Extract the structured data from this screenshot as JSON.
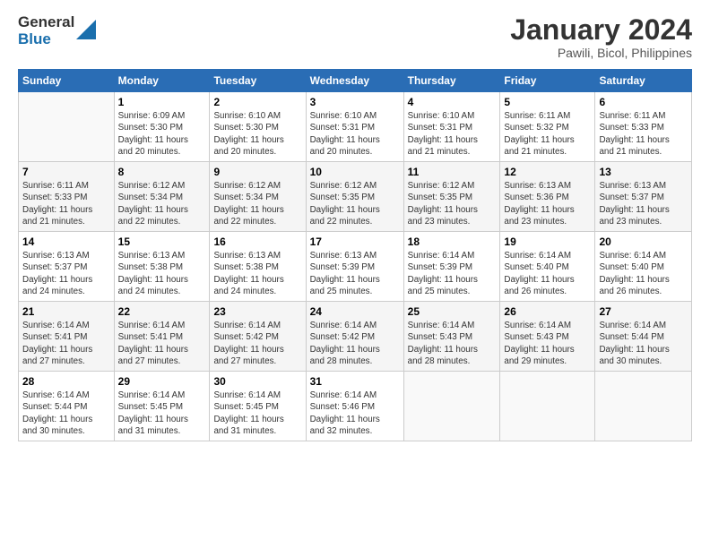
{
  "logo": {
    "general": "General",
    "blue": "Blue"
  },
  "title": "January 2024",
  "subtitle": "Pawili, Bicol, Philippines",
  "headers": [
    "Sunday",
    "Monday",
    "Tuesday",
    "Wednesday",
    "Thursday",
    "Friday",
    "Saturday"
  ],
  "weeks": [
    [
      {
        "day": "",
        "info": ""
      },
      {
        "day": "1",
        "info": "Sunrise: 6:09 AM\nSunset: 5:30 PM\nDaylight: 11 hours\nand 20 minutes."
      },
      {
        "day": "2",
        "info": "Sunrise: 6:10 AM\nSunset: 5:30 PM\nDaylight: 11 hours\nand 20 minutes."
      },
      {
        "day": "3",
        "info": "Sunrise: 6:10 AM\nSunset: 5:31 PM\nDaylight: 11 hours\nand 20 minutes."
      },
      {
        "day": "4",
        "info": "Sunrise: 6:10 AM\nSunset: 5:31 PM\nDaylight: 11 hours\nand 21 minutes."
      },
      {
        "day": "5",
        "info": "Sunrise: 6:11 AM\nSunset: 5:32 PM\nDaylight: 11 hours\nand 21 minutes."
      },
      {
        "day": "6",
        "info": "Sunrise: 6:11 AM\nSunset: 5:33 PM\nDaylight: 11 hours\nand 21 minutes."
      }
    ],
    [
      {
        "day": "7",
        "info": "Sunrise: 6:11 AM\nSunset: 5:33 PM\nDaylight: 11 hours\nand 21 minutes."
      },
      {
        "day": "8",
        "info": "Sunrise: 6:12 AM\nSunset: 5:34 PM\nDaylight: 11 hours\nand 22 minutes."
      },
      {
        "day": "9",
        "info": "Sunrise: 6:12 AM\nSunset: 5:34 PM\nDaylight: 11 hours\nand 22 minutes."
      },
      {
        "day": "10",
        "info": "Sunrise: 6:12 AM\nSunset: 5:35 PM\nDaylight: 11 hours\nand 22 minutes."
      },
      {
        "day": "11",
        "info": "Sunrise: 6:12 AM\nSunset: 5:35 PM\nDaylight: 11 hours\nand 23 minutes."
      },
      {
        "day": "12",
        "info": "Sunrise: 6:13 AM\nSunset: 5:36 PM\nDaylight: 11 hours\nand 23 minutes."
      },
      {
        "day": "13",
        "info": "Sunrise: 6:13 AM\nSunset: 5:37 PM\nDaylight: 11 hours\nand 23 minutes."
      }
    ],
    [
      {
        "day": "14",
        "info": "Sunrise: 6:13 AM\nSunset: 5:37 PM\nDaylight: 11 hours\nand 24 minutes."
      },
      {
        "day": "15",
        "info": "Sunrise: 6:13 AM\nSunset: 5:38 PM\nDaylight: 11 hours\nand 24 minutes."
      },
      {
        "day": "16",
        "info": "Sunrise: 6:13 AM\nSunset: 5:38 PM\nDaylight: 11 hours\nand 24 minutes."
      },
      {
        "day": "17",
        "info": "Sunrise: 6:13 AM\nSunset: 5:39 PM\nDaylight: 11 hours\nand 25 minutes."
      },
      {
        "day": "18",
        "info": "Sunrise: 6:14 AM\nSunset: 5:39 PM\nDaylight: 11 hours\nand 25 minutes."
      },
      {
        "day": "19",
        "info": "Sunrise: 6:14 AM\nSunset: 5:40 PM\nDaylight: 11 hours\nand 26 minutes."
      },
      {
        "day": "20",
        "info": "Sunrise: 6:14 AM\nSunset: 5:40 PM\nDaylight: 11 hours\nand 26 minutes."
      }
    ],
    [
      {
        "day": "21",
        "info": "Sunrise: 6:14 AM\nSunset: 5:41 PM\nDaylight: 11 hours\nand 27 minutes."
      },
      {
        "day": "22",
        "info": "Sunrise: 6:14 AM\nSunset: 5:41 PM\nDaylight: 11 hours\nand 27 minutes."
      },
      {
        "day": "23",
        "info": "Sunrise: 6:14 AM\nSunset: 5:42 PM\nDaylight: 11 hours\nand 27 minutes."
      },
      {
        "day": "24",
        "info": "Sunrise: 6:14 AM\nSunset: 5:42 PM\nDaylight: 11 hours\nand 28 minutes."
      },
      {
        "day": "25",
        "info": "Sunrise: 6:14 AM\nSunset: 5:43 PM\nDaylight: 11 hours\nand 28 minutes."
      },
      {
        "day": "26",
        "info": "Sunrise: 6:14 AM\nSunset: 5:43 PM\nDaylight: 11 hours\nand 29 minutes."
      },
      {
        "day": "27",
        "info": "Sunrise: 6:14 AM\nSunset: 5:44 PM\nDaylight: 11 hours\nand 30 minutes."
      }
    ],
    [
      {
        "day": "28",
        "info": "Sunrise: 6:14 AM\nSunset: 5:44 PM\nDaylight: 11 hours\nand 30 minutes."
      },
      {
        "day": "29",
        "info": "Sunrise: 6:14 AM\nSunset: 5:45 PM\nDaylight: 11 hours\nand 31 minutes."
      },
      {
        "day": "30",
        "info": "Sunrise: 6:14 AM\nSunset: 5:45 PM\nDaylight: 11 hours\nand 31 minutes."
      },
      {
        "day": "31",
        "info": "Sunrise: 6:14 AM\nSunset: 5:46 PM\nDaylight: 11 hours\nand 32 minutes."
      },
      {
        "day": "",
        "info": ""
      },
      {
        "day": "",
        "info": ""
      },
      {
        "day": "",
        "info": ""
      }
    ]
  ]
}
